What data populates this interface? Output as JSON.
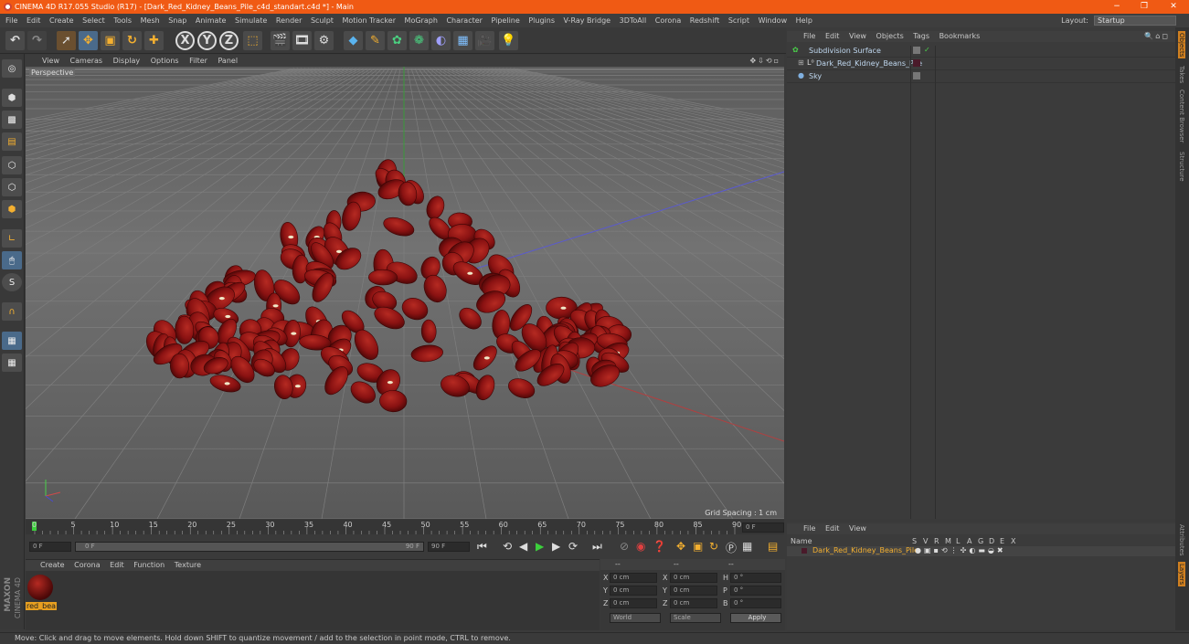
{
  "window": {
    "title": "CINEMA 4D R17.055 Studio (R17) - [Dark_Red_Kidney_Beans_Pile_c4d_standart.c4d *] - Main",
    "minimize": "−",
    "restore": "❐",
    "close": "✕"
  },
  "menu": [
    "File",
    "Edit",
    "Create",
    "Select",
    "Tools",
    "Mesh",
    "Snap",
    "Animate",
    "Simulate",
    "Render",
    "Sculpt",
    "Motion Tracker",
    "MoGraph",
    "Character",
    "Pipeline",
    "Plugins",
    "V-Ray Bridge",
    "3DToAll",
    "Corona",
    "Redshift",
    "Script",
    "Window",
    "Help"
  ],
  "layout": {
    "label": "Layout:",
    "value": "Startup"
  },
  "toolbar": {
    "x": "X",
    "y": "Y",
    "z": "Z"
  },
  "viewport": {
    "menu": [
      "View",
      "Cameras",
      "Display",
      "Options",
      "Filter",
      "Panel"
    ],
    "label": "Perspective",
    "grid_spacing": "Grid Spacing : 1 cm",
    "bean_color": "#8a1212"
  },
  "timeline": {
    "ticks": [
      "0",
      "5",
      "10",
      "15",
      "20",
      "25",
      "30",
      "35",
      "40",
      "45",
      "50",
      "55",
      "60",
      "65",
      "70",
      "75",
      "80",
      "85",
      "90"
    ],
    "frame_field": "0 F"
  },
  "transport": {
    "start": "0 F",
    "range_start": "0 F",
    "range_end": "90 F",
    "end": "90 F"
  },
  "material": {
    "menu": [
      "Create",
      "Corona",
      "Edit",
      "Function",
      "Texture"
    ],
    "name": "red_bea"
  },
  "coords": {
    "header": [
      "--",
      "--",
      "--"
    ],
    "rows": [
      {
        "a": "X",
        "av": "0 cm",
        "b": "X",
        "bv": "0 cm",
        "c": "H",
        "cv": "0 °"
      },
      {
        "a": "Y",
        "av": "0 cm",
        "b": "Y",
        "bv": "0 cm",
        "c": "P",
        "cv": "0 °"
      },
      {
        "a": "Z",
        "av": "0 cm",
        "b": "Z",
        "bv": "0 cm",
        "c": "B",
        "cv": "0 °"
      }
    ],
    "world": "World",
    "scale": "Scale",
    "apply": "Apply"
  },
  "objects": {
    "menu": [
      "File",
      "Edit",
      "View",
      "Objects",
      "Tags",
      "Bookmarks"
    ],
    "items": [
      "Subdivision Surface",
      "Dark_Red_Kidney_Beans_Pile",
      "Sky"
    ]
  },
  "layers": {
    "menu": [
      "File",
      "Edit",
      "View"
    ],
    "name_header": "Name",
    "cols": [
      "S",
      "V",
      "R",
      "M",
      "L",
      "A",
      "G",
      "D",
      "E",
      "X"
    ],
    "item": "Dark_Red_Kidney_Beans_Pile"
  },
  "sidetabs": [
    "Objects",
    "Takes",
    "Content Browser",
    "Structure"
  ],
  "sidetabs2": [
    "Attributes",
    "Layers"
  ],
  "brand": {
    "line1": "MAXON",
    "line2": "CINEMA 4D"
  },
  "status": "Move: Click and drag to move elements. Hold down SHIFT to quantize movement / add to the selection in point mode, CTRL to remove."
}
